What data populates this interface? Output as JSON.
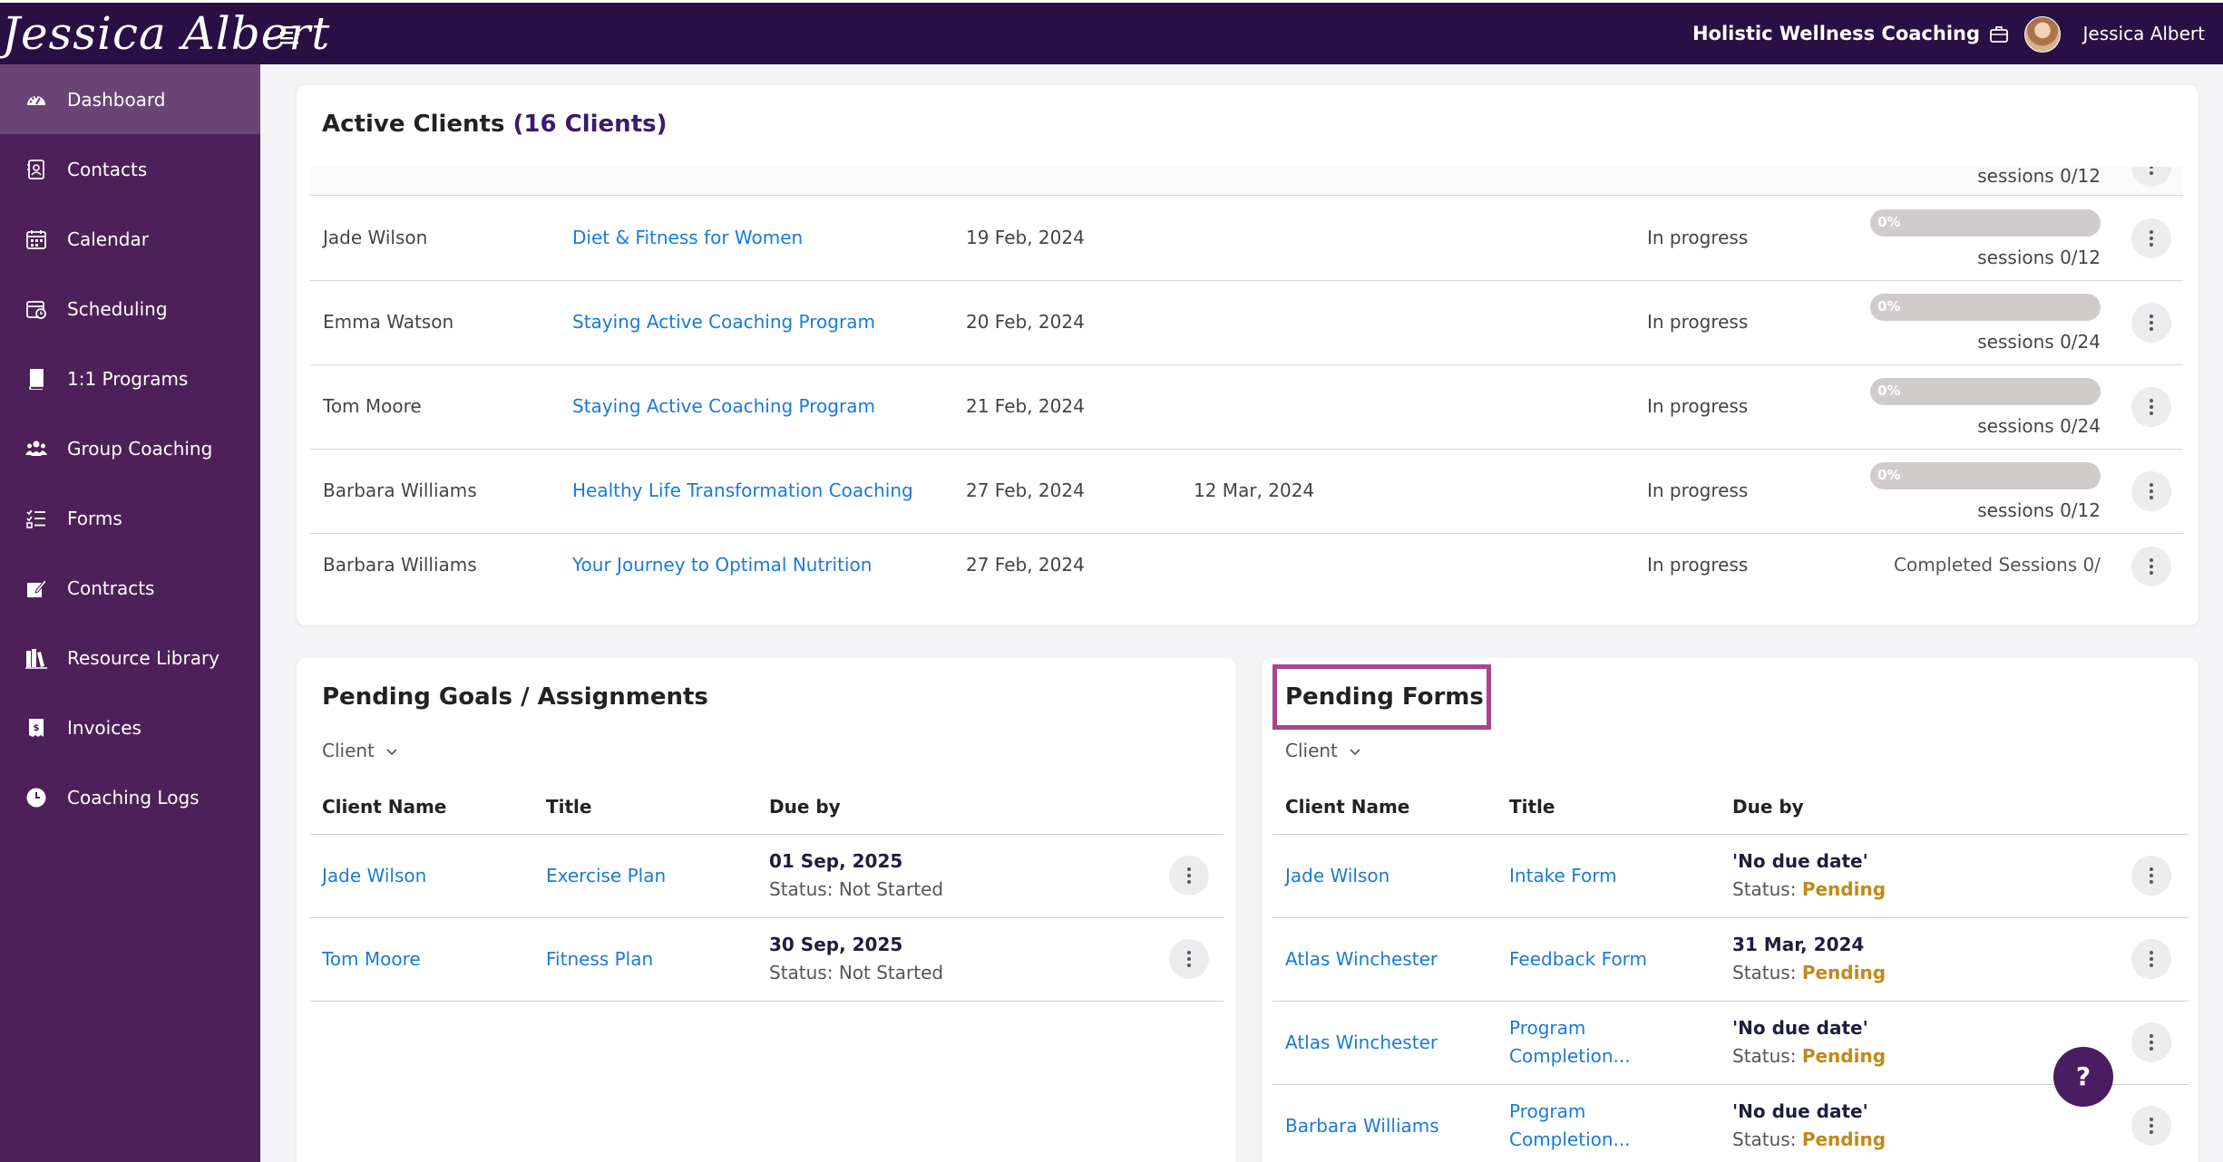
{
  "brand": {
    "logo_text": "Jessica Albert"
  },
  "header": {
    "org_name": "Holistic Wellness Coaching",
    "user_name": "Jessica Albert"
  },
  "sidebar": {
    "items": [
      {
        "label": "Dashboard",
        "icon": "dashboard-icon",
        "active": true
      },
      {
        "label": "Contacts",
        "icon": "contacts-icon"
      },
      {
        "label": "Calendar",
        "icon": "calendar-icon"
      },
      {
        "label": "Scheduling",
        "icon": "scheduling-icon"
      },
      {
        "label": "1:1 Programs",
        "icon": "book-icon"
      },
      {
        "label": "Group Coaching",
        "icon": "group-icon"
      },
      {
        "label": "Forms",
        "icon": "forms-icon"
      },
      {
        "label": "Contracts",
        "icon": "contract-icon"
      },
      {
        "label": "Resource Library",
        "icon": "library-icon"
      },
      {
        "label": "Invoices",
        "icon": "invoice-icon"
      },
      {
        "label": "Coaching Logs",
        "icon": "clock-icon"
      }
    ]
  },
  "active_clients": {
    "title": "Active Clients",
    "count": "(16 Clients)",
    "partial_row_sessions": "sessions 0/12",
    "rows": [
      {
        "name": "Jade Wilson",
        "program": "Diet & Fitness for Women",
        "start": "19 Feb, 2024",
        "end": "",
        "status": "In progress",
        "progress_label": "0%",
        "progress": 0,
        "sessions": "sessions 0/12"
      },
      {
        "name": "Emma Watson",
        "program": "Staying Active Coaching Program",
        "start": "20 Feb, 2024",
        "end": "",
        "status": "In progress",
        "progress_label": "0%",
        "progress": 0,
        "sessions": "sessions 0/24"
      },
      {
        "name": "Tom Moore",
        "program": "Staying Active Coaching Program",
        "start": "21 Feb, 2024",
        "end": "",
        "status": "In progress",
        "progress_label": "0%",
        "progress": 0,
        "sessions": "sessions 0/24"
      },
      {
        "name": "Barbara Williams",
        "program": "Healthy Life Transformation Coaching",
        "start": "27 Feb, 2024",
        "end": "12 Mar, 2024",
        "status": "In progress",
        "progress_label": "0%",
        "progress": 0,
        "sessions": "sessions 0/12"
      },
      {
        "name": "Barbara Williams",
        "program": "Your Journey to Optimal Nutrition",
        "start": "27 Feb, 2024",
        "end": "",
        "status": "In progress",
        "completed_sessions": "Completed Sessions 0/"
      }
    ]
  },
  "pending_goals": {
    "title": "Pending Goals / Assignments",
    "filter_label": "Client",
    "columns": [
      "Client Name",
      "Title",
      "Due by"
    ],
    "rows": [
      {
        "client": "Jade Wilson",
        "title": "Exercise Plan",
        "due": "01 Sep, 2025",
        "status_label": "Status:",
        "status": "Not Started"
      },
      {
        "client": "Tom Moore",
        "title": "Fitness Plan",
        "due": "30 Sep, 2025",
        "status_label": "Status:",
        "status": "Not Started"
      }
    ]
  },
  "pending_forms": {
    "title": "Pending Forms",
    "filter_label": "Client",
    "columns": [
      "Client Name",
      "Title",
      "Due by"
    ],
    "rows": [
      {
        "client": "Jade Wilson",
        "title_line1": "Intake Form",
        "title_line2": "",
        "due": "'No due date'",
        "status_label": "Status:",
        "status": "Pending"
      },
      {
        "client": "Atlas Winchester",
        "title_line1": "Feedback Form",
        "title_line2": "",
        "due": "31 Mar, 2024",
        "status_label": "Status:",
        "status": "Pending"
      },
      {
        "client": "Atlas Winchester",
        "title_line1": "Program",
        "title_line2": "Completion...",
        "due": "'No due date'",
        "status_label": "Status:",
        "status": "Pending"
      },
      {
        "client": "Barbara Williams",
        "title_line1": "Program",
        "title_line2": "Completion...",
        "due": "'No due date'",
        "status_label": "Status:",
        "status": "Pending"
      }
    ]
  },
  "help_button": {
    "label": "?"
  },
  "colors": {
    "topbar": "#2a0f45",
    "sidebar": "#4e2059",
    "link": "#1a7ad9",
    "pending": "#c08a18",
    "highlight": "#a5468f"
  }
}
